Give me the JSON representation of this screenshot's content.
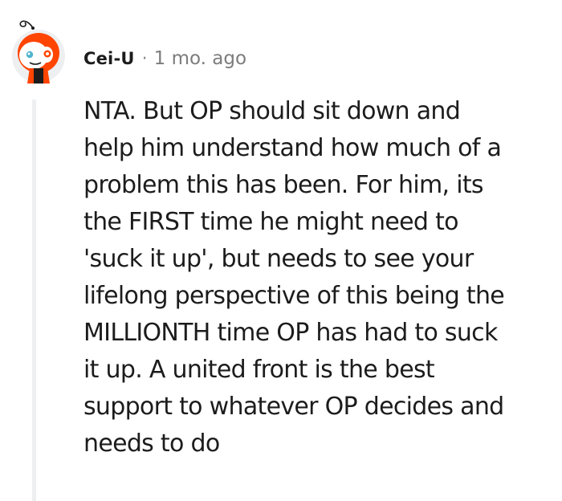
{
  "comment": {
    "author": "Cei-U",
    "separator": "·",
    "timestamp": "1 mo. ago",
    "avatar_icon": "snoo-avatar-icon",
    "body_lines": [
      "NTA. But OP should sit down and",
      "help him understand how much of a",
      "problem this has been. For him, its",
      "the FIRST time he might need to",
      "'suck it up', but needs to see your",
      "lifelong perspective of this being the",
      "MILLIONTH time OP has had to suck",
      "it up. A united front is the best",
      "support to whatever OP decides and",
      "needs to do"
    ]
  },
  "colors": {
    "avatar_orange": "#ff4500",
    "avatar_background": "#edeff1",
    "thread_line": "#edeff1",
    "text": "#1c1c1c",
    "meta_text": "#7c7c7c"
  }
}
